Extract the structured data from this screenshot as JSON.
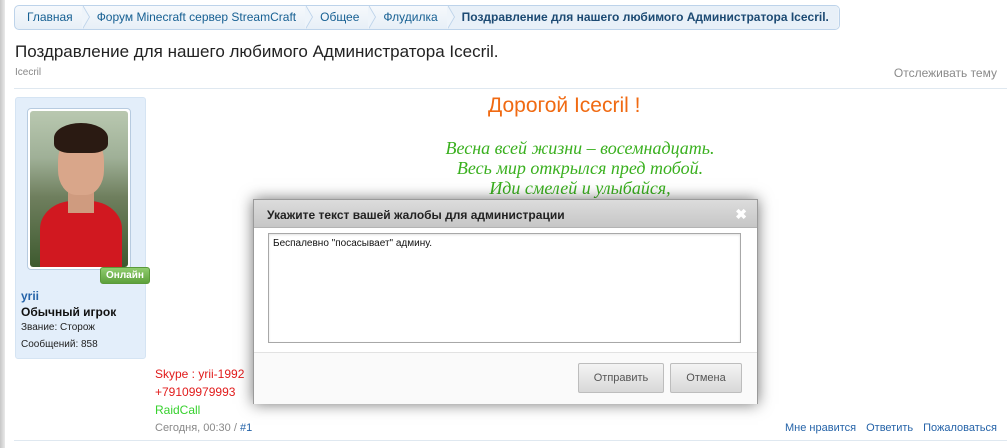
{
  "breadcrumb": [
    "Главная",
    "Форум Minecraft сервер StreamCraft",
    "Общее",
    "Флудилка",
    "Поздравление для нашего любимого Администратора Icecril."
  ],
  "thread": {
    "title": "Поздравление для нашего любимого Администратора Icecril.",
    "starter": "Icecril",
    "watch_label": "Отслеживать тему"
  },
  "user": {
    "status_badge": "Онлайн",
    "name": "yrii",
    "title": "Обычный игрок",
    "rank": "Звание: Сторож",
    "messages": "Сообщений: 858"
  },
  "post": {
    "greeting": "Дорогой Icecril !",
    "poem": [
      "Весна всей жизни – восемнадцать.",
      "Весь мир открылся пред тобой.",
      "Иди смелей и улыбайся,"
    ],
    "signature": {
      "skype": "Skype : yrii-1992",
      "phone": "+79109979993",
      "raidcall": "RaidCall"
    },
    "date": "Сегодня, 00:30 /",
    "permalink": "#1",
    "actions": {
      "like": "Мне нравится",
      "reply": "Ответить",
      "report": "Пожаловаться"
    }
  },
  "report_dialog": {
    "title": "Укажите текст вашей жалобы для администрации",
    "close_icon": "close-icon",
    "text_value": "Беспалевно \"посасывает\" админу.",
    "send_label": "Отправить",
    "cancel_label": "Отмена"
  },
  "colors": {
    "greeting": "#f06a12",
    "poem": "#3ab01f",
    "signature_red": "#e11b1b",
    "signature_green": "#37d12e",
    "link_blue": "#2563a8"
  }
}
